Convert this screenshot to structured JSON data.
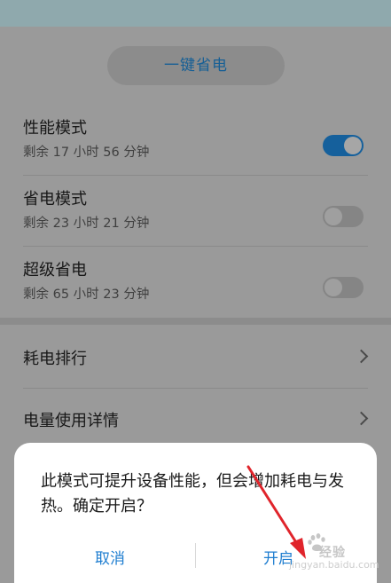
{
  "header": {
    "one_key_saver_label": "一键省电"
  },
  "modes": [
    {
      "title": "性能模式",
      "remaining": "剩余 17 小时 56 分钟",
      "enabled": true
    },
    {
      "title": "省电模式",
      "remaining": "剩余 23 小时 21 分钟",
      "enabled": false
    },
    {
      "title": "超级省电",
      "remaining": "剩余 65 小时 23 分钟",
      "enabled": false
    }
  ],
  "nav": [
    {
      "label": "耗电排行"
    },
    {
      "label": "电量使用详情"
    }
  ],
  "dialog": {
    "message": "此模式可提升设备性能，但会增加耗电与发热。确定开启？",
    "cancel_label": "取消",
    "confirm_label": "开启"
  },
  "watermark": {
    "text": "经验",
    "url": "jingyan.baidu.com"
  },
  "colors": {
    "accent": "#1f7ed0",
    "arrow": "#e0242b"
  }
}
